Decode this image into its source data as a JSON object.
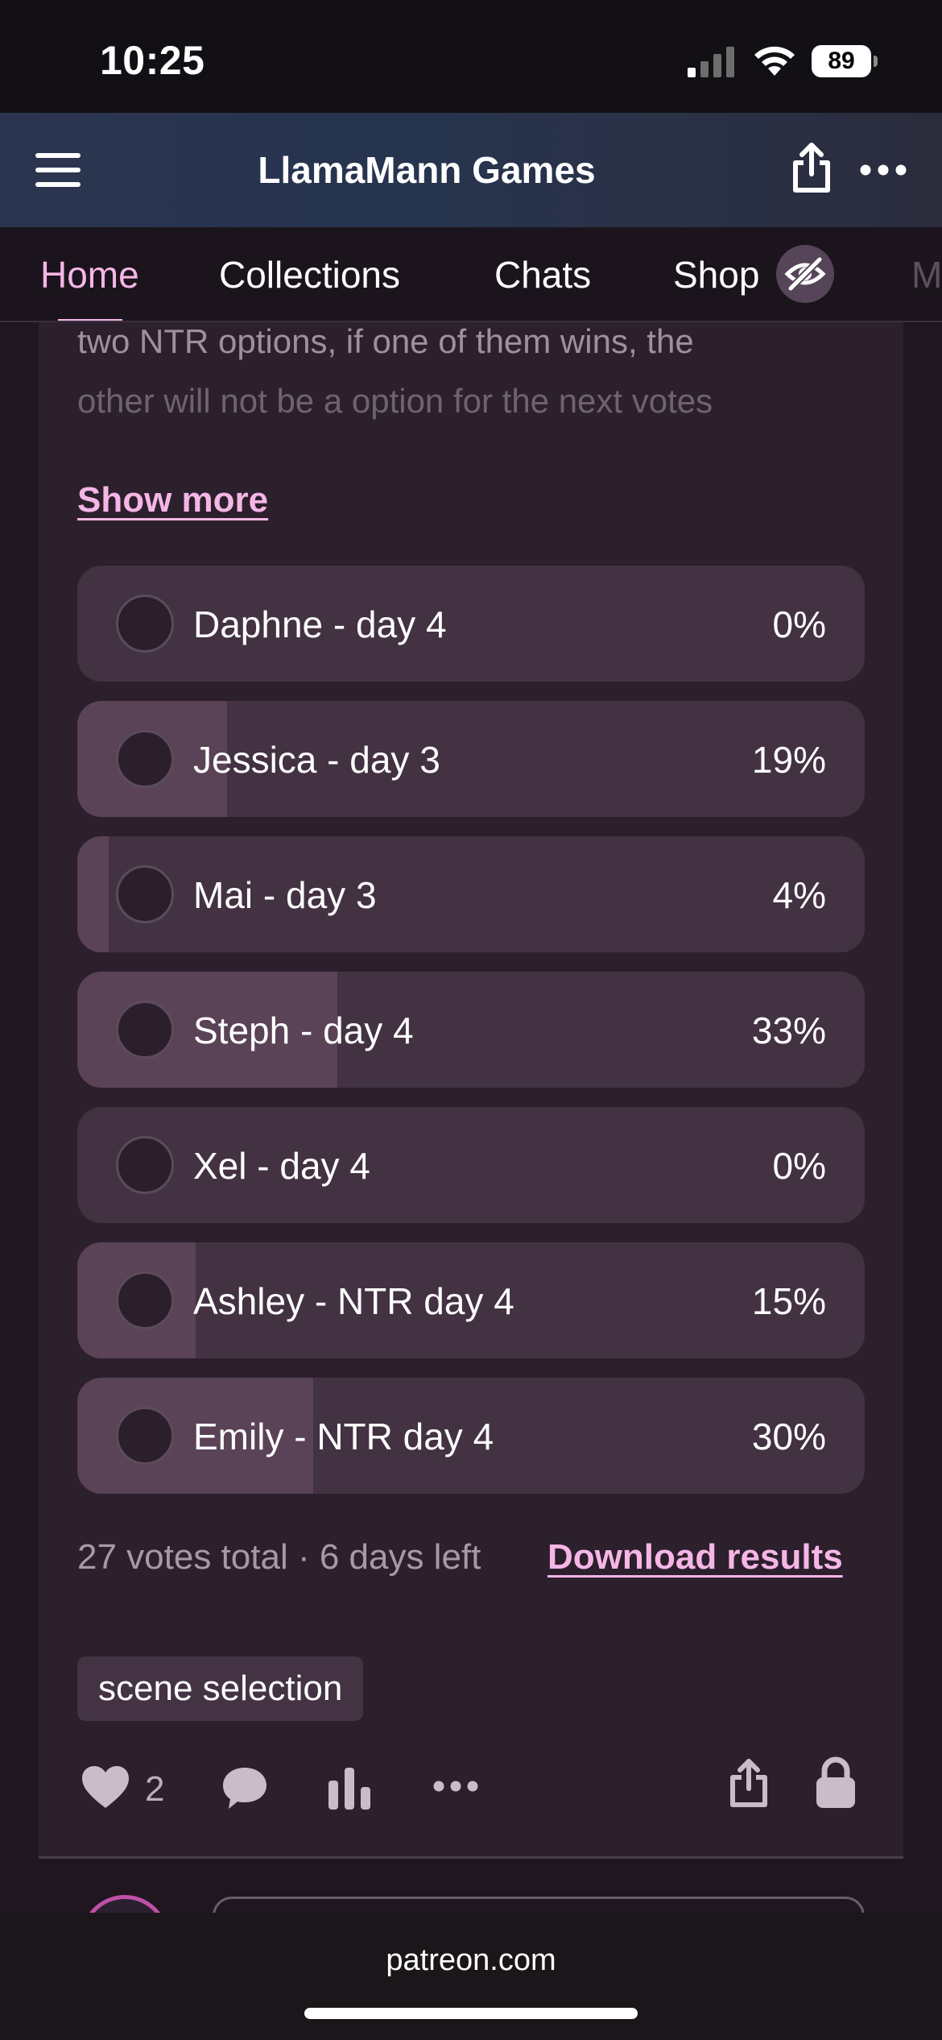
{
  "status_bar": {
    "time": "10:25",
    "battery": "89"
  },
  "header": {
    "title": "LlamaMann Games"
  },
  "tabs": [
    {
      "label": "Home",
      "active": true
    },
    {
      "label": "Collections"
    },
    {
      "label": "Chats"
    },
    {
      "label": "Shop"
    },
    {
      "label": "M"
    }
  ],
  "post": {
    "description_lines": [
      "two NTR options, if one of them wins, the",
      "other will not be a option for the next votes"
    ],
    "show_more": "Show more",
    "poll": {
      "options": [
        {
          "label": "Daphne - day 4",
          "percent": "0%",
          "fraction": 0.0
        },
        {
          "label": "Jessica - day 3",
          "percent": "19%",
          "fraction": 0.19
        },
        {
          "label": "Mai - day 3",
          "percent": "4%",
          "fraction": 0.04
        },
        {
          "label": "Steph - day 4",
          "percent": "33%",
          "fraction": 0.33
        },
        {
          "label": "Xel - day 4",
          "percent": "0%",
          "fraction": 0.0
        },
        {
          "label": "Ashley - NTR day 4",
          "percent": "15%",
          "fraction": 0.15
        },
        {
          "label": "Emily - NTR day 4",
          "percent": "30%",
          "fraction": 0.3
        }
      ],
      "footer": "27 votes total · 6 days left",
      "download": "Download results"
    },
    "tag": "scene selection",
    "likes": "2"
  },
  "browser": {
    "url": "patreon.com"
  },
  "colors": {
    "accent": "#f5b6e6",
    "card": "#2d202d",
    "option": "#433242",
    "fill": "#5a4257"
  }
}
